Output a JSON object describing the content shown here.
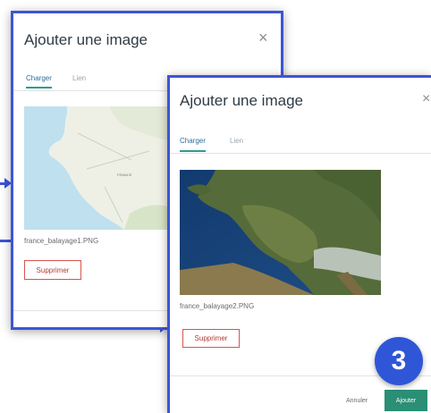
{
  "dialog_back": {
    "title": "Ajouter une image",
    "close_symbol": "×",
    "tabs": [
      {
        "label": "Charger",
        "active": true
      },
      {
        "label": "Lien",
        "active": false
      }
    ],
    "filename": "france_balayage1.PNG",
    "remove_label": "Supprimer",
    "map_labels": [
      "FRANCE"
    ]
  },
  "dialog_front": {
    "title": "Ajouter une image",
    "close_symbol": "×",
    "tabs": [
      {
        "label": "Charger",
        "active": true
      },
      {
        "label": "Lien",
        "active": false
      }
    ],
    "filename": "france_balayage2.PNG",
    "remove_label": "Supprimer",
    "cancel_label": "Annuler",
    "add_label": "Ajouter"
  },
  "step_badge": "3",
  "colors": {
    "accent_blue": "#3d55d6",
    "badge_blue": "#2f56d6",
    "add_green": "#2a8f74",
    "remove_red": "#d9534f",
    "tab_underline": "#2a9d8f"
  }
}
